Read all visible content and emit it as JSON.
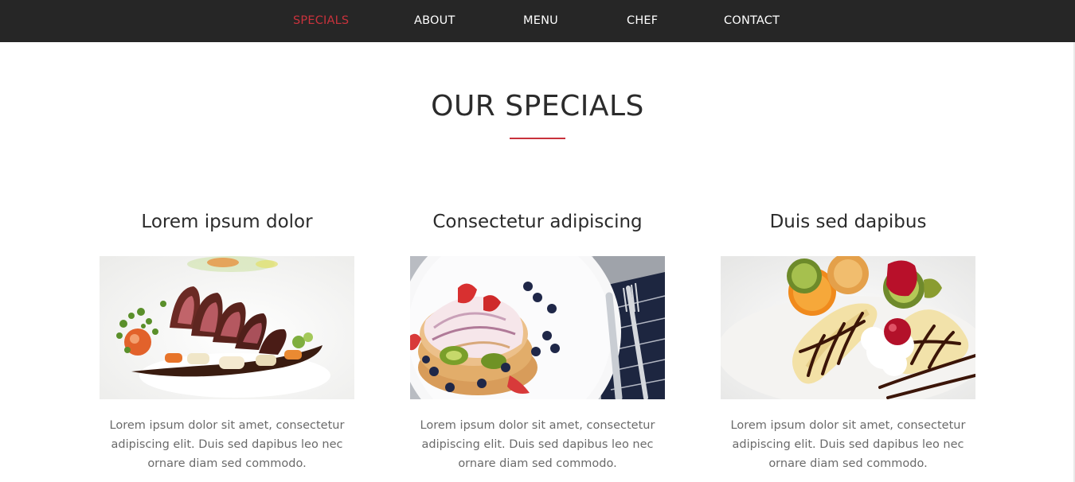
{
  "nav": {
    "items": [
      {
        "label": "SPECIALS",
        "active": true
      },
      {
        "label": "ABOUT",
        "active": false
      },
      {
        "label": "MENU",
        "active": false
      },
      {
        "label": "CHEF",
        "active": false
      },
      {
        "label": "CONTACT",
        "active": false
      }
    ],
    "active_color": "#c8323c",
    "background": "#262626"
  },
  "section": {
    "title": "OUR SPECIALS",
    "accent_color": "#c8323c"
  },
  "specials": [
    {
      "title": "Lorem ipsum dolor",
      "image": "seared-duck-plate-photo",
      "text": "Lorem ipsum dolor sit amet, consectetur adipiscing elit. Duis sed dapibus leo nec ornare diam sed commodo."
    },
    {
      "title": "Consectetur adipiscing",
      "image": "pancake-fruit-plate-photo",
      "text": "Lorem ipsum dolor sit amet, consectetur adipiscing elit. Duis sed dapibus leo nec ornare diam sed commodo."
    },
    {
      "title": "Duis sed dapibus",
      "image": "banana-chocolate-dessert-photo",
      "text": "Lorem ipsum dolor sit amet, consectetur adipiscing elit. Duis sed dapibus leo nec ornare diam sed commodo."
    }
  ]
}
